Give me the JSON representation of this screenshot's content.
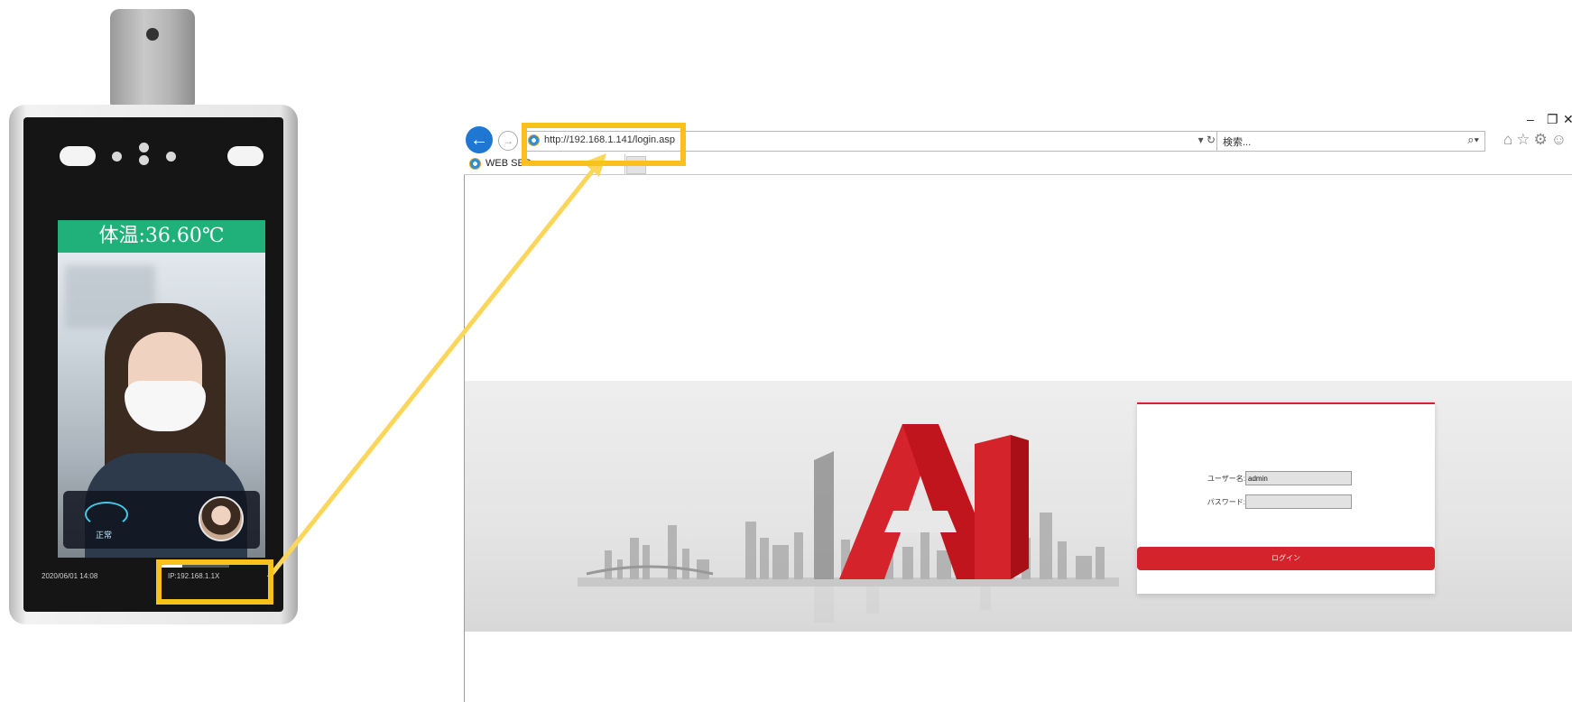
{
  "device": {
    "temperature_banner": "体温:36.60℃",
    "panel_label": "正常",
    "status_date": "2020/06/01  14:08",
    "status_ip": "IP:192.168.1.1X",
    "progress_fraction": 0.35,
    "banner_color": "#20b07a",
    "icons": [
      "camera-lens-icon",
      "ir-light-icon",
      "sensor-icon",
      "thermal-icon",
      "avatar-icon"
    ]
  },
  "browser": {
    "url": "http://192.168.1.141/login.asp",
    "address_controls": "▾ ↻",
    "search_placeholder": "検索...",
    "search_icon": "⌕▾",
    "toolbar_icons": "⌂☆⚙☺",
    "window_controls": {
      "minimize": "–",
      "restore": "❐",
      "close": "✕"
    },
    "tab_title": "WEB SER",
    "back_glyph": "←",
    "forward_glyph": "→"
  },
  "login": {
    "username_label": "ユーザー名:",
    "username_value": "admin",
    "password_label": "パスワード:",
    "password_value": "",
    "login_button": "ログイン"
  },
  "colors": {
    "highlight": "#f9c11c",
    "accent_red": "#d5232b",
    "ie_blue": "#1e77d3"
  }
}
